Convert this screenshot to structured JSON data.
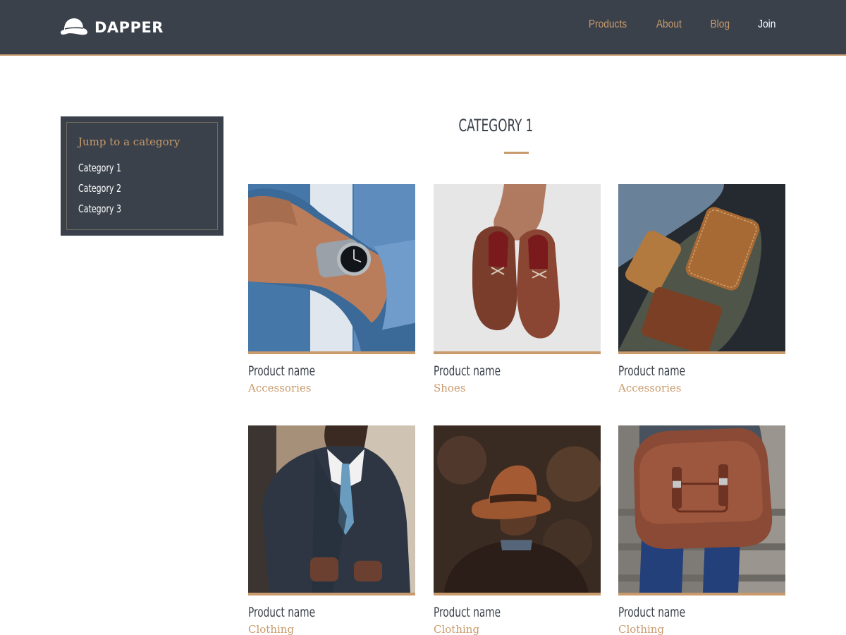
{
  "brand": {
    "name": "DAPPER",
    "logo_icon": "bowler-hat-icon"
  },
  "nav": [
    {
      "label": "Products",
      "color": "#c99a6b"
    },
    {
      "label": "About",
      "color": "#c99a6b"
    },
    {
      "label": "Blog",
      "color": "#c99a6b"
    },
    {
      "label": "Join",
      "color": "#ffffff"
    }
  ],
  "sidebar": {
    "title": "Jump to a category",
    "items": [
      {
        "label": "Category 1"
      },
      {
        "label": "Category 2"
      },
      {
        "label": "Category 3"
      }
    ]
  },
  "category": {
    "title": "CATEGORY 1"
  },
  "products": [
    {
      "name": "Product name",
      "category": "Accessories",
      "photo": "wristwatch-photo"
    },
    {
      "name": "Product name",
      "category": "Shoes",
      "photo": "brown-shoes-photo"
    },
    {
      "name": "Product name",
      "category": "Accessories",
      "photo": "leather-cases-photo"
    },
    {
      "name": "Product name",
      "category": "Clothing",
      "photo": "suit-man-photo"
    },
    {
      "name": "Product name",
      "category": "Clothing",
      "photo": "fedora-hat-photo"
    },
    {
      "name": "Product name",
      "category": "Clothing",
      "photo": "leather-satchel-photo"
    }
  ],
  "colors": {
    "dark": "#3a414b",
    "accent": "#c99a6b",
    "white": "#ffffff"
  }
}
